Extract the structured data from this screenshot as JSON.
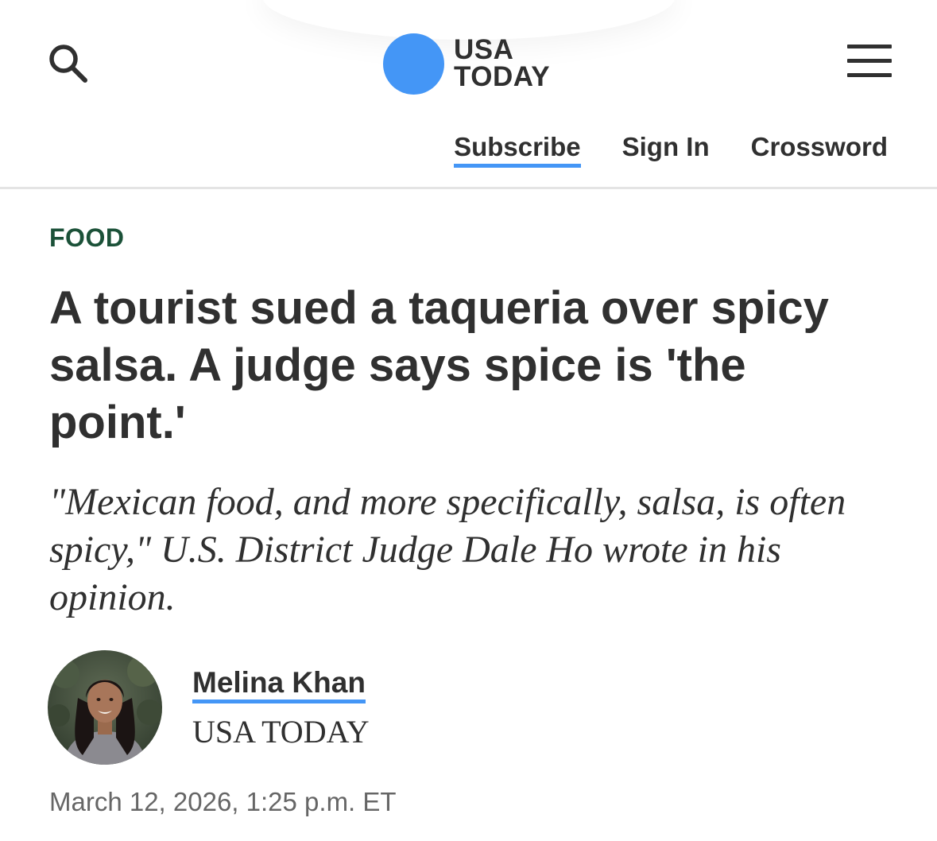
{
  "header": {
    "logo_line1": "USA",
    "logo_line2": "TODAY",
    "brand_color": "#4496f6",
    "nav": {
      "subscribe": "Subscribe",
      "sign_in": "Sign In",
      "crossword": "Crossword"
    },
    "icons": {
      "search": "search-icon",
      "menu": "menu-icon"
    }
  },
  "article": {
    "category": "FOOD",
    "category_color": "#1b5138",
    "headline": "A tourist sued a taqueria over spicy salsa. A judge says spice is 'the point.'",
    "summary": "\"Mexican food, and more specifically, salsa, is often spicy,\" U.S. District Judge Dale Ho wrote in his opinion.",
    "author": {
      "name": "Melina Khan",
      "organization": "USA TODAY"
    },
    "timestamp": "March 12, 2026, 1:25 p.m. ET"
  }
}
